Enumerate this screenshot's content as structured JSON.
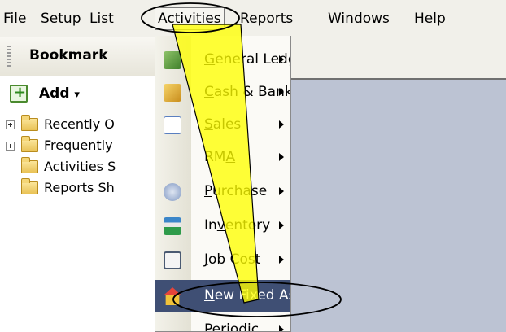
{
  "menubar": {
    "items": [
      {
        "label": "File",
        "ul": "F",
        "rest": "ile"
      },
      {
        "label": "Setup",
        "pre": "Setu",
        "ul": "p",
        "rest": ""
      },
      {
        "label": "List",
        "ul": "L",
        "rest": "ist"
      },
      {
        "label": "Activities",
        "ul": "A",
        "rest": "ctivities"
      },
      {
        "label": "Reports",
        "ul": "R",
        "rest": "eports"
      },
      {
        "label": "Windows",
        "pre": "Win",
        "ul": "d",
        "rest": "ows"
      },
      {
        "label": "Help",
        "ul": "H",
        "rest": "elp"
      }
    ]
  },
  "panel": {
    "title": "Bookmark",
    "add_label": "Add",
    "add_caret": "▾",
    "items": [
      {
        "label": "Recently O"
      },
      {
        "label": "Frequently"
      },
      {
        "label": "Activities S"
      },
      {
        "label": "Reports Sh"
      }
    ]
  },
  "dropdown": {
    "items": [
      {
        "pre": "",
        "ul": "G",
        "rest": "eneral Ledger",
        "icon": "ledger-icon",
        "color": "#5a9a3c"
      },
      {
        "pre": "",
        "ul": "C",
        "rest": "ash & Bank",
        "icon": "cash-bank-icon",
        "color": "#d9a62c"
      },
      {
        "pre": "",
        "ul": "S",
        "rest": "ales",
        "icon": "sales-icon",
        "color": "#3d6fc6"
      },
      {
        "pre": "RM",
        "ul": "A",
        "rest": "",
        "icon": "",
        "color": ""
      },
      {
        "pre": "",
        "ul": "P",
        "rest": "urchase",
        "icon": "purchase-icon",
        "color": "#6f8fc0"
      },
      {
        "pre": "In",
        "ul": "v",
        "rest": "entory",
        "icon": "inventory-icon",
        "color": "#2f7fbf"
      },
      {
        "pre": "",
        "ul": "J",
        "rest": "ob Cost",
        "icon": "job-cost-icon",
        "color": "#5a6a80"
      },
      {
        "pre": "",
        "ul": "N",
        "rest": "ew Fixed Asset",
        "icon": "house-icon",
        "color": "#e08a22"
      },
      {
        "pre": "Periodic",
        "ul": "",
        "rest": "",
        "icon": "",
        "color": ""
      }
    ]
  },
  "colors": {
    "selection": "#3f4f74",
    "callout_fill": "#ffff00"
  }
}
